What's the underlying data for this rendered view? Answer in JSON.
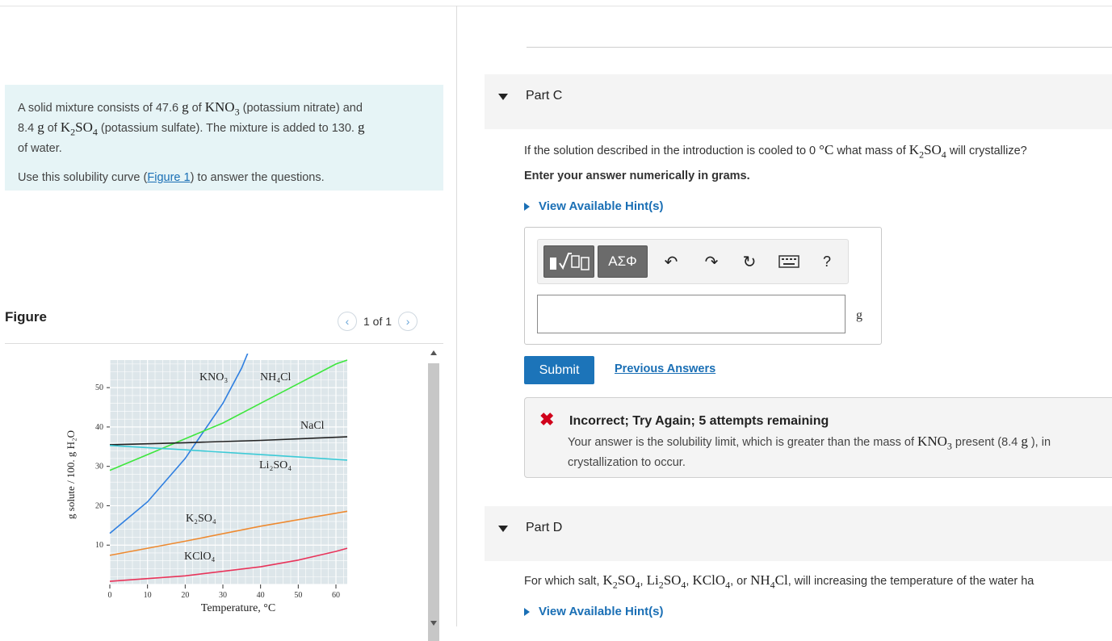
{
  "intro": {
    "l1_a": "A solid mixture consists of 47.6 ",
    "l1_g1": "g",
    "l1_b": " of ",
    "l1_c": " (potassium nitrate) and",
    "l2_a": "8.4 ",
    "l2_g": "g",
    "l2_b": " of ",
    "l2_c": " (potassium sulfate).  The mixture is added to 130. ",
    "l2_g2": "g",
    "l3": "of water.",
    "p2_a": "Use this solubility curve (",
    "p2_link": "Figure 1",
    "p2_b": ") to answer the questions."
  },
  "figure": {
    "heading": "Figure",
    "pager": "1 of 1",
    "prev_icon": "chevron-left-icon",
    "next_icon": "chevron-right-icon"
  },
  "chart_data": {
    "type": "line",
    "title": "",
    "xlabel": "Temperature, °C",
    "ylabel": "g solute / 100. g H₂O",
    "xlim": [
      0,
      63
    ],
    "ylim": [
      0,
      57
    ],
    "xticks": [
      0,
      10,
      20,
      30,
      40,
      50,
      60
    ],
    "yticks": [
      10,
      20,
      30,
      40,
      50
    ],
    "grid": true,
    "series": [
      {
        "name": "KNO₃",
        "color": "#2f7fe0",
        "points": [
          [
            0,
            13
          ],
          [
            10,
            21
          ],
          [
            20,
            32
          ],
          [
            30,
            46
          ],
          [
            35,
            55
          ],
          [
            38,
            62
          ]
        ]
      },
      {
        "name": "NH₄Cl",
        "color": "#3ee63e",
        "points": [
          [
            0,
            29
          ],
          [
            10,
            33
          ],
          [
            20,
            37
          ],
          [
            30,
            41
          ],
          [
            40,
            46
          ],
          [
            50,
            51
          ],
          [
            60,
            56
          ],
          [
            63,
            57
          ]
        ]
      },
      {
        "name": "NaCl",
        "color": "#222222",
        "points": [
          [
            0,
            35.5
          ],
          [
            20,
            36
          ],
          [
            40,
            36.6
          ],
          [
            63,
            37.5
          ]
        ]
      },
      {
        "name": "Li₂SO₄",
        "color": "#3ccad6",
        "points": [
          [
            0,
            35.3
          ],
          [
            20,
            34.2
          ],
          [
            40,
            33
          ],
          [
            63,
            31.6
          ]
        ]
      },
      {
        "name": "K₂SO₄",
        "color": "#ee8a30",
        "points": [
          [
            0,
            7.4
          ],
          [
            20,
            11
          ],
          [
            40,
            14.8
          ],
          [
            63,
            18.6
          ]
        ]
      },
      {
        "name": "KClO₄",
        "color": "#e8345a",
        "points": [
          [
            0,
            0.8
          ],
          [
            20,
            2.2
          ],
          [
            40,
            4.5
          ],
          [
            50,
            6.2
          ],
          [
            60,
            8.4
          ],
          [
            63,
            9.2
          ]
        ]
      }
    ]
  },
  "partC": {
    "title": "Part C",
    "q_a": "If the solution described in the introduction is cooled to 0 ",
    "q_unit": "°C",
    "q_b": " what mass of ",
    "q_c": " will crystallize?",
    "instr": "Enter your answer numerically in grams.",
    "hint": "View Available Hint(s)",
    "toolbar_templates": "templates-icon",
    "toolbar_symbols": "ΑΣΦ",
    "undo_icon": "undo-icon",
    "redo_icon": "redo-icon",
    "reset_icon": "reset-icon",
    "keyboard_icon": "keyboard-icon",
    "help": "?",
    "unit": "g",
    "submit": "Submit",
    "previous": "Previous Answers"
  },
  "feedback": {
    "title": "Incorrect; Try Again; 5 attempts remaining",
    "text_a": "Your answer is the solubility limit, which is greater than the mass of ",
    "text_b": " present (8.4 ",
    "text_g": "g",
    "text_c": " ), in",
    "text2": "crystallization to occur."
  },
  "partD": {
    "title": "Part D",
    "q_a": "For which salt, ",
    "sep": ", ",
    "q_or": ", or ",
    "q_b": ", will increasing the temperature of the water ha",
    "hint": "View Available Hint(s)"
  },
  "colors": {
    "accent": "#1a6fb5",
    "intro_bg": "#e6f4f6",
    "error": "#d0021b",
    "submit_bg": "#1c74b9"
  }
}
